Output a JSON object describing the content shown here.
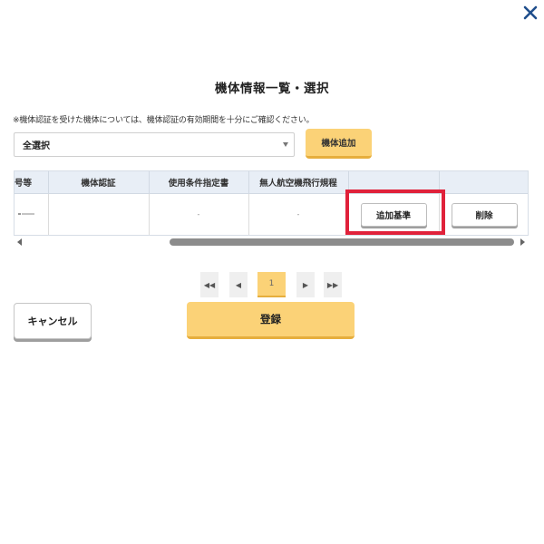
{
  "dialog": {
    "title": "機体情報一覧・選択",
    "notice": "※機体認証を受けた機体については、機体認証の有効期間を十分にご確認ください。"
  },
  "filter": {
    "selected": "全選択",
    "add_machine_label": "機体追加"
  },
  "table": {
    "headers": [
      "号等",
      "機体認証",
      "使用条件指定書",
      "無人航空機飛行規程",
      "",
      ""
    ],
    "rows": [
      {
        "machine_cert": "",
        "usage_doc": "-",
        "flight_rules": "-",
        "add_standard_label": "追加基準",
        "delete_label": "削除"
      }
    ]
  },
  "pagination": {
    "first": "◀◀",
    "prev": "◀",
    "current": "1",
    "next": "▶",
    "last": "▶▶"
  },
  "footer": {
    "cancel_label": "キャンセル",
    "register_label": "登録"
  },
  "colors": {
    "accent": "#fbd277",
    "highlight": "#e0213a",
    "header_bg": "#e8eef6"
  },
  "icons": {
    "close": "close-icon"
  }
}
